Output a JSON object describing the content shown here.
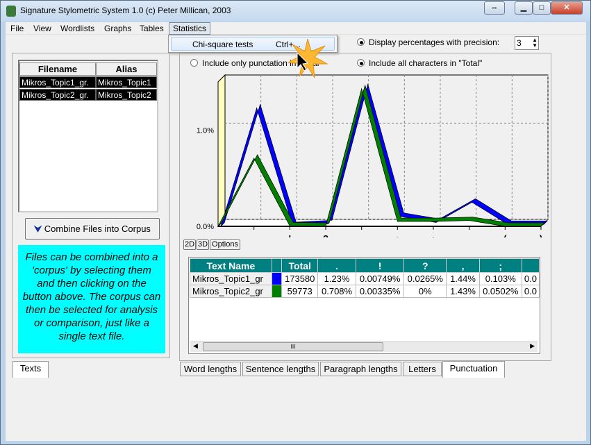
{
  "window": {
    "title": "Signature Stylometric System 1.0  (c) Peter Millican, 2003"
  },
  "menu": [
    "File",
    "View",
    "Wordlists",
    "Graphs",
    "Tables",
    "Statistics"
  ],
  "dropdown": {
    "item": "Chi-square tests",
    "shortcut": "Ctrl+..."
  },
  "texts_panel": {
    "headers": [
      "Filename",
      "Alias"
    ],
    "rows": [
      [
        "Mikros_Topic1_gr.",
        "Mikros_Topic1"
      ],
      [
        "Mikros_Topic2_gr.",
        "Mikros_Topic2"
      ]
    ],
    "combine_button": "Combine Files into Corpus",
    "info": "Files can be combined into a 'corpus' by selecting them and then clicking on the button above.  The corpus can then be selected for analysis or comparison, just like a single text file.",
    "tab": "Texts"
  },
  "options": {
    "precision_label": "Display percentages with precision:",
    "precision_value": "3",
    "radio_punct": "Include only punctation in \"Total\"",
    "radio_all": "Include all characters in \"Total\""
  },
  "graph_buttons": [
    "2D",
    "3D",
    "Options"
  ],
  "chart_data": {
    "type": "line",
    "categories": [
      ".",
      "!",
      "?",
      ",",
      ";",
      ":",
      "-",
      "(",
      ")"
    ],
    "ytick_labels": [
      "0.0%",
      "1.0%"
    ],
    "ylim": [
      0,
      1.5
    ],
    "grid": true,
    "3d": true,
    "series": [
      {
        "name": "Mikros_Topic1_gr",
        "color": "#0000ff",
        "values": [
          1.23,
          0.00749,
          0.0265,
          1.44,
          0.103,
          0.04,
          0.25,
          0.02,
          0.02
        ]
      },
      {
        "name": "Mikros_Topic2_gr",
        "color": "#008000",
        "values": [
          0.708,
          0.00335,
          0,
          1.43,
          0.0502,
          0.05,
          0.06,
          0,
          0
        ]
      }
    ]
  },
  "table": {
    "headers": [
      "Text Name",
      "",
      "Total",
      ".",
      "!",
      "?",
      ",",
      ";",
      "..."
    ],
    "rows": [
      {
        "name": "Mikros_Topic1_gr",
        "color": "#0000ff",
        "cells": [
          "173580",
          "1.23%",
          "0.00749%",
          "0.0265%",
          "1.44%",
          "0.103%",
          "0.0"
        ]
      },
      {
        "name": "Mikros_Topic2_gr",
        "color": "#008000",
        "cells": [
          "59773",
          "0.708%",
          "0.00335%",
          "0%",
          "1.43%",
          "0.0502%",
          "0.0"
        ]
      }
    ]
  },
  "bottom_tabs": [
    "Word lengths",
    "Sentence lengths",
    "Paragraph lengths",
    "Letters",
    "Punctuation"
  ],
  "scroll_grip": "III"
}
